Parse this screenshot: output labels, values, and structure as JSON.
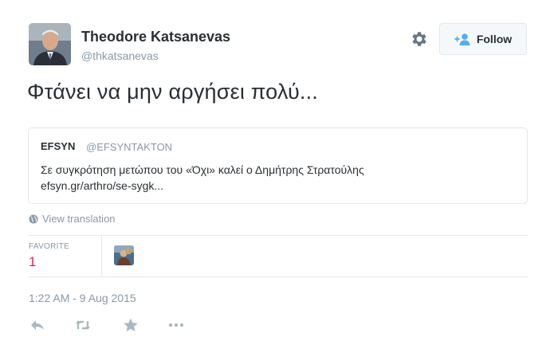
{
  "user": {
    "display_name": "Theodore Katsanevas",
    "handle": "@thkatsanevas"
  },
  "follow_button": {
    "label": "Follow"
  },
  "tweet": {
    "text": "Φτάνει να μην αργήσει πολύ..."
  },
  "quote": {
    "name": "EFSYN",
    "handle": "@EFSYNTAKTON",
    "text": "Σε συγκρότηση μετώπου του «Όχι» καλεί ο Δημήτρης Στρατούλης",
    "link": "efsyn.gr/arthro/se-sygk..."
  },
  "translation_link": "View translation",
  "stats": {
    "favorite_label": "FAVORITE",
    "favorite_count": "1"
  },
  "timestamp": "1:22 AM - 9 Aug 2015",
  "actions": [
    "reply-icon",
    "retweet-icon",
    "favorite-star-icon",
    "more-icon"
  ],
  "colors": {
    "accent": "#55acee",
    "favorite": "#e0245e",
    "muted": "#8899a6",
    "border": "#e1e8ed",
    "text": "#292f33"
  }
}
